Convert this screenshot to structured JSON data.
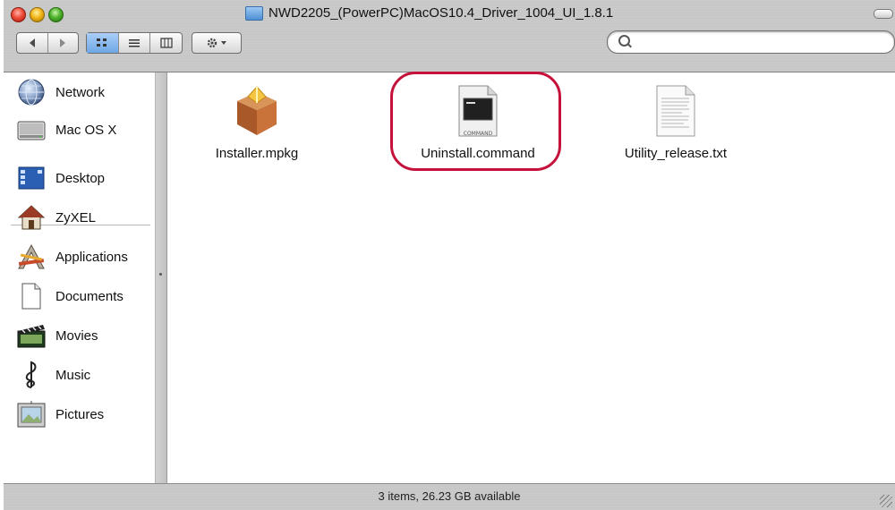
{
  "window": {
    "title": "NWD2205_(PowerPC)MacOS10.4_Driver_1004_UI_1.8.1"
  },
  "toolbar": {
    "nav_back_icon": "back-arrow-icon",
    "nav_forward_icon": "forward-arrow-icon",
    "views": [
      "icon-view-icon",
      "list-view-icon",
      "column-view-icon"
    ],
    "active_view": "icon-view-icon",
    "action_icon": "gear-icon",
    "search_icon": "search-icon"
  },
  "sidebar": {
    "devices": [
      {
        "label": "Network",
        "icon": "network-globe-icon"
      },
      {
        "label": "Mac OS X",
        "icon": "hard-drive-icon"
      }
    ],
    "places": [
      {
        "label": "Desktop",
        "icon": "desktop-icon"
      },
      {
        "label": "ZyXEL",
        "icon": "home-icon"
      },
      {
        "label": "Applications",
        "icon": "applications-icon"
      },
      {
        "label": "Documents",
        "icon": "documents-icon"
      },
      {
        "label": "Movies",
        "icon": "movies-icon"
      },
      {
        "label": "Music",
        "icon": "music-icon"
      },
      {
        "label": "Pictures",
        "icon": "pictures-icon"
      }
    ]
  },
  "files": [
    {
      "name": "Installer.mpkg",
      "icon": "package-icon"
    },
    {
      "name": "Uninstall.command",
      "icon": "command-icon",
      "icon_caption": "COMMAND"
    },
    {
      "name": "Utility_release.txt",
      "icon": "text-document-icon"
    }
  ],
  "colors": {
    "highlight": "#c5123b",
    "chrome": "#c8c8c8",
    "view_active": "#6ea7e6"
  },
  "status": {
    "text": "3 items, 26.23 GB available"
  }
}
